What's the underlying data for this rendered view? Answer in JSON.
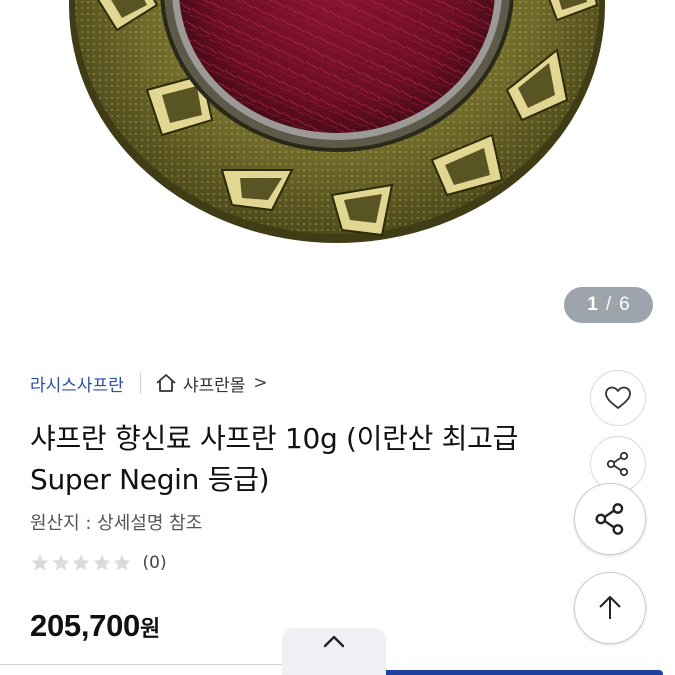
{
  "gallery": {
    "current_page": "1",
    "separator": "/",
    "total_pages": "6"
  },
  "store": {
    "name": "라시스사프란",
    "mall_link_label": "샤프란몰",
    "mall_link_chevron": ">"
  },
  "product": {
    "title": "샤프란 향신료 사프란 10g (이란산 최고급 Super Negin 등급)",
    "origin": "원산지 : 상세설명 참조",
    "rating_stars": 0,
    "rating_max": 5,
    "review_count": "(0)",
    "price": "205,700",
    "price_unit": "원"
  },
  "icons": {
    "wishlist": "heart-icon",
    "share": "share-icon",
    "scroll_top": "arrow-up-icon",
    "drawer": "chevron-up-icon",
    "store_home": "home-icon"
  },
  "colors": {
    "store_link": "#2e4fa8",
    "page_indicator_bg": "#9ea4ab",
    "primary_button": "#1f3f9f",
    "star_empty": "#d9dbde"
  }
}
